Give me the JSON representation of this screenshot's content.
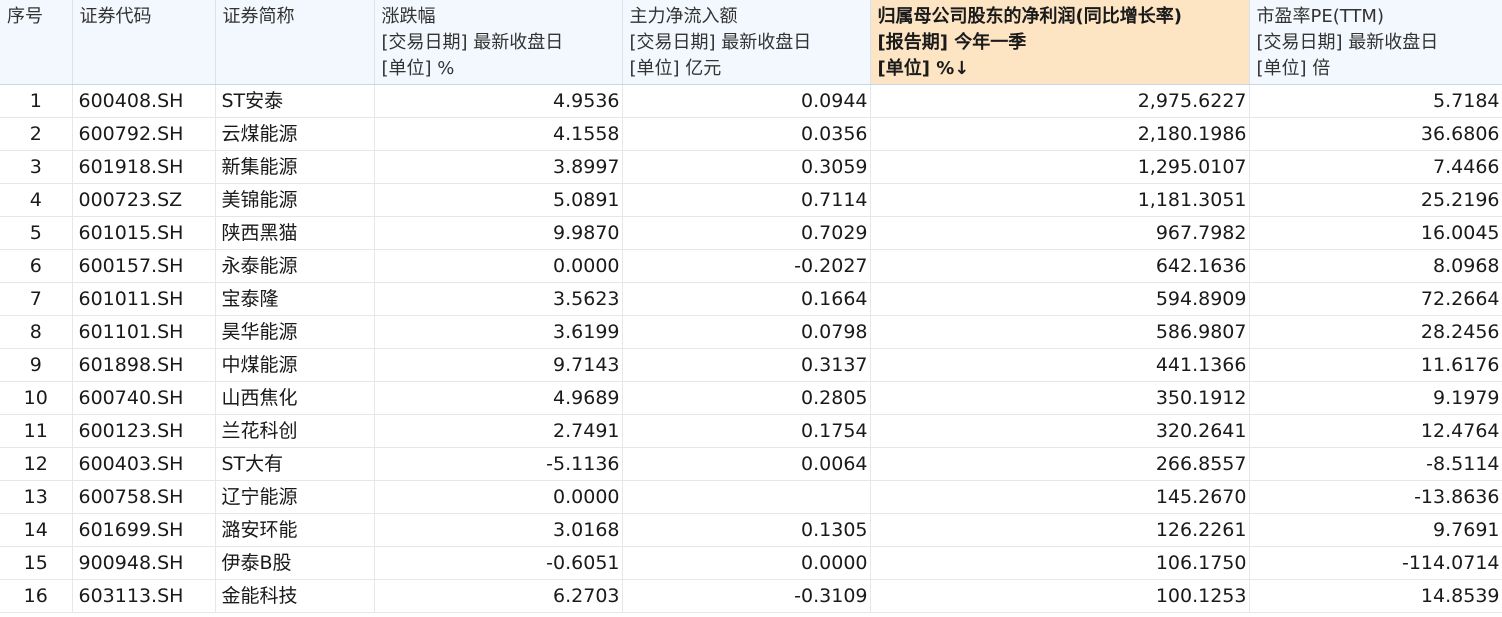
{
  "table": {
    "headers": [
      {
        "lines": [
          "序号"
        ]
      },
      {
        "lines": [
          "证券代码"
        ]
      },
      {
        "lines": [
          "证券简称"
        ]
      },
      {
        "lines": [
          "涨跌幅",
          "[交易日期] 最新收盘日",
          "[单位] %"
        ]
      },
      {
        "lines": [
          "主力净流入额",
          "[交易日期] 最新收盘日",
          "[单位] 亿元"
        ]
      },
      {
        "lines": [
          "归属母公司股东的净利润(同比增长率)",
          "[报告期] 今年一季",
          "[单位] %↓"
        ],
        "sorted": true
      },
      {
        "lines": [
          "市盈率PE(TTM)",
          "[交易日期] 最新收盘日",
          "[单位] 倍"
        ]
      }
    ],
    "rows": [
      [
        "1",
        "600408.SH",
        "ST安泰",
        "4.9536",
        "0.0944",
        "2,975.6227",
        "5.7184"
      ],
      [
        "2",
        "600792.SH",
        "云煤能源",
        "4.1558",
        "0.0356",
        "2,180.1986",
        "36.6806"
      ],
      [
        "3",
        "601918.SH",
        "新集能源",
        "3.8997",
        "0.3059",
        "1,295.0107",
        "7.4466"
      ],
      [
        "4",
        "000723.SZ",
        "美锦能源",
        "5.0891",
        "0.7114",
        "1,181.3051",
        "25.2196"
      ],
      [
        "5",
        "601015.SH",
        "陕西黑猫",
        "9.9870",
        "0.7029",
        "967.7982",
        "16.0045"
      ],
      [
        "6",
        "600157.SH",
        "永泰能源",
        "0.0000",
        "-0.2027",
        "642.1636",
        "8.0968"
      ],
      [
        "7",
        "601011.SH",
        "宝泰隆",
        "3.5623",
        "0.1664",
        "594.8909",
        "72.2664"
      ],
      [
        "8",
        "601101.SH",
        "昊华能源",
        "3.6199",
        "0.0798",
        "586.9807",
        "28.2456"
      ],
      [
        "9",
        "601898.SH",
        "中煤能源",
        "9.7143",
        "0.3137",
        "441.1366",
        "11.6176"
      ],
      [
        "10",
        "600740.SH",
        "山西焦化",
        "4.9689",
        "0.2805",
        "350.1912",
        "9.1979"
      ],
      [
        "11",
        "600123.SH",
        "兰花科创",
        "2.7491",
        "0.1754",
        "320.2641",
        "12.4764"
      ],
      [
        "12",
        "600403.SH",
        "ST大有",
        "-5.1136",
        "0.0064",
        "266.8557",
        "-8.5114"
      ],
      [
        "13",
        "600758.SH",
        "辽宁能源",
        "0.0000",
        "",
        "145.2670",
        "-13.8636"
      ],
      [
        "14",
        "601699.SH",
        "潞安环能",
        "3.0168",
        "0.1305",
        "126.2261",
        "9.7691"
      ],
      [
        "15",
        "900948.SH",
        "伊泰B股",
        "-0.6051",
        "0.0000",
        "106.1750",
        "-114.0714"
      ],
      [
        "16",
        "603113.SH",
        "金能科技",
        "6.2703",
        "-0.3109",
        "100.1253",
        "14.8539"
      ]
    ]
  }
}
